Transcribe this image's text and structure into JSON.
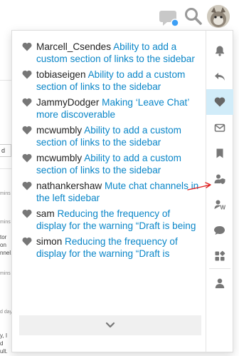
{
  "header": {
    "chat_icon": "chat-bubble-icon",
    "search_icon": "search-icon",
    "avatar_icon": "cat-avatar",
    "chat_badge_color": "#3d9ff5"
  },
  "background": {
    "box_text": "d",
    "snippets": [
      "mins",
      "mins",
      "tor",
      "on",
      "nnel.",
      "mins",
      "d day",
      "y, I",
      "d",
      "ult."
    ]
  },
  "notifications": [
    {
      "user": "Marcell_Csendes",
      "topic": "Ability to add a custom section of links to the sidebar"
    },
    {
      "user": "tobiaseigen",
      "topic": "Ability to add a custom section of links to the sidebar"
    },
    {
      "user": "JammyDodger",
      "topic": "Making ‘Leave Chat’ more discoverable"
    },
    {
      "user": "mcwumbly",
      "topic": "Ability to add a custom section of links to the sidebar"
    },
    {
      "user": "mcwumbly",
      "topic": "Ability to add a custom section of links to the sidebar"
    },
    {
      "user": "nathankershaw",
      "topic": "Mute chat channels in the left sidebar"
    },
    {
      "user": "sam",
      "topic": "Reducing the frequency of display for the warning “Draft is being edited…"
    },
    {
      "user": "simon",
      "topic": "Reducing the frequency of display for the warning “Draft is being…"
    }
  ],
  "footer": {
    "icon": "chevron-down-icon"
  },
  "tabs": [
    {
      "name": "tab-all-notifications",
      "icon": "bell-icon"
    },
    {
      "name": "tab-replies",
      "icon": "reply-icon"
    },
    {
      "name": "tab-likes",
      "icon": "heart-icon",
      "active": true
    },
    {
      "name": "tab-messages",
      "icon": "envelope-icon"
    },
    {
      "name": "tab-bookmarks",
      "icon": "bookmark-icon"
    },
    {
      "name": "tab-reviewables",
      "icon": "user-shield-icon"
    },
    {
      "name": "tab-badges",
      "icon": "wrap-user-icon"
    },
    {
      "name": "tab-chat",
      "icon": "comment-icon"
    },
    {
      "name": "tab-sidebar",
      "icon": "grid-icon"
    },
    {
      "name": "tab-profile",
      "icon": "user-icon"
    }
  ],
  "colors": {
    "link": "#0a86c8",
    "active_tab_bg": "#d1ecf9",
    "icon_gray": "#777777",
    "annotation_red": "#e02020"
  }
}
